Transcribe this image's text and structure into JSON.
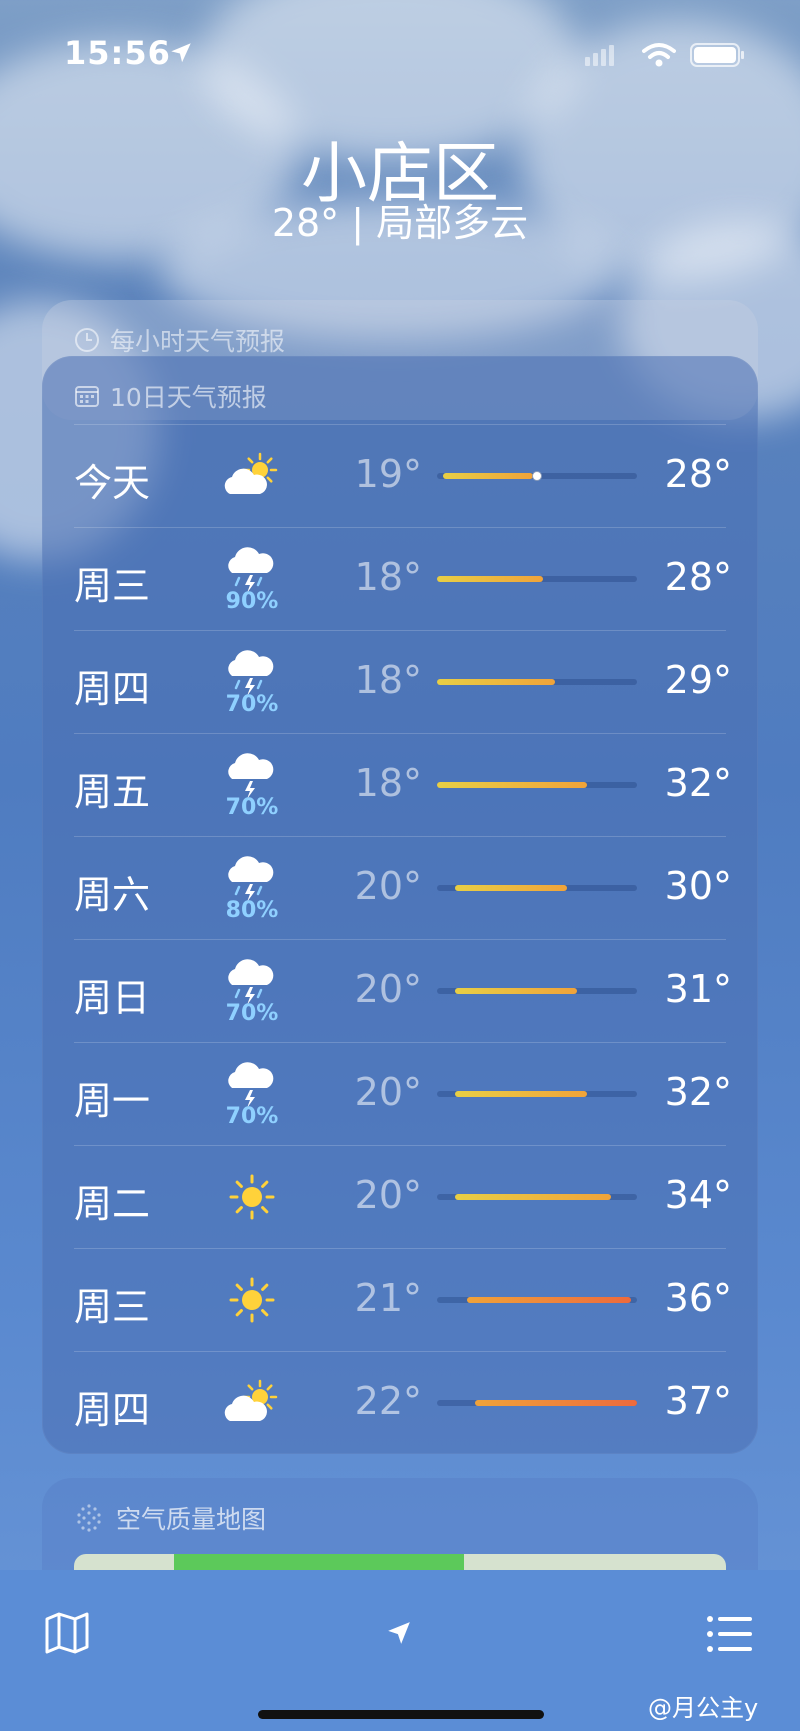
{
  "status_bar": {
    "time": "15:56"
  },
  "location": {
    "city": "小店区",
    "summary": "28° | 局部多云"
  },
  "hourly_card": {
    "title": "每小时天气预报"
  },
  "forecast": {
    "title": "10日天气预报",
    "days": [
      {
        "day": "今天",
        "icon": "partly-sunny-icon",
        "pop": "",
        "low": "19°",
        "high": "28°",
        "bar_start": 0.03,
        "bar_end": 0.48,
        "current": 0.5
      },
      {
        "day": "周三",
        "icon": "thunderstorm-icon",
        "pop": "90%",
        "low": "18°",
        "high": "28°",
        "bar_start": 0.0,
        "bar_end": 0.53
      },
      {
        "day": "周四",
        "icon": "thunderstorm-icon",
        "pop": "70%",
        "low": "18°",
        "high": "29°",
        "bar_start": 0.0,
        "bar_end": 0.59
      },
      {
        "day": "周五",
        "icon": "thunder-cloud-icon",
        "pop": "70%",
        "low": "18°",
        "high": "32°",
        "bar_start": 0.0,
        "bar_end": 0.75
      },
      {
        "day": "周六",
        "icon": "thunderstorm-icon",
        "pop": "80%",
        "low": "20°",
        "high": "30°",
        "bar_start": 0.09,
        "bar_end": 0.65
      },
      {
        "day": "周日",
        "icon": "thunderstorm-icon",
        "pop": "70%",
        "low": "20°",
        "high": "31°",
        "bar_start": 0.09,
        "bar_end": 0.7
      },
      {
        "day": "周一",
        "icon": "thunder-cloud-icon",
        "pop": "70%",
        "low": "20°",
        "high": "32°",
        "bar_start": 0.09,
        "bar_end": 0.75
      },
      {
        "day": "周二",
        "icon": "sun-icon",
        "pop": "",
        "low": "20°",
        "high": "34°",
        "bar_start": 0.09,
        "bar_end": 0.87
      },
      {
        "day": "周三",
        "icon": "sun-icon",
        "pop": "",
        "low": "21°",
        "high": "36°",
        "bar_start": 0.15,
        "bar_end": 0.97
      },
      {
        "day": "周四",
        "icon": "partly-sunny-icon",
        "pop": "",
        "low": "22°",
        "high": "37°",
        "bar_start": 0.19,
        "bar_end": 1.0
      }
    ]
  },
  "air_quality": {
    "title": "空气质量地图"
  },
  "watermark": "@月公主y",
  "colors": {
    "cool": "#e8cf45",
    "warm": "#f0a33a",
    "hot": "#ee6a3c",
    "pop": "#8fd0ff"
  }
}
